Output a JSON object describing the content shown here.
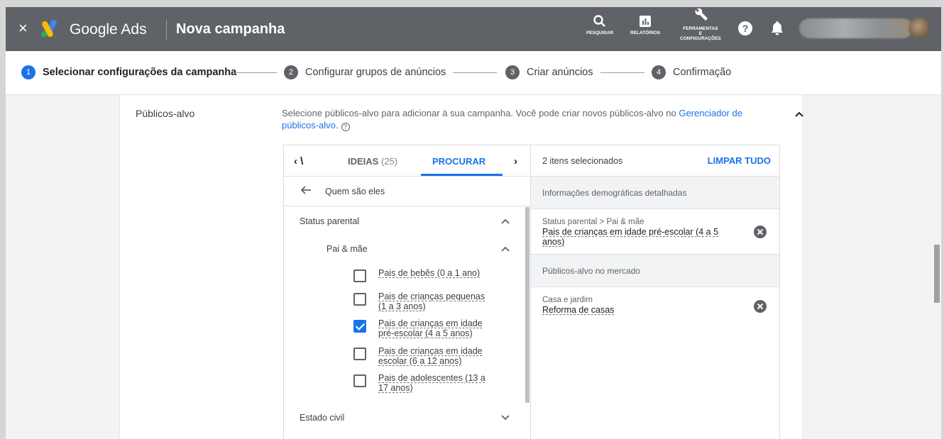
{
  "app": {
    "brand": "Google Ads",
    "title": "Nova campanha",
    "close_glyph": "×"
  },
  "topbar": {
    "search_label": "PESQUISAR",
    "reports_label": "RELATÓRIOS",
    "tools_label_line1": "FERRAMENTAS",
    "tools_label_line2": "E",
    "tools_label_line3": "CONFIGURAÇÕES",
    "help_glyph": "?",
    "icons": [
      "close-icon",
      "google-ads-logo",
      "search-icon",
      "reports-icon",
      "wrench-icon",
      "help-icon",
      "bell-icon"
    ]
  },
  "stepper": {
    "steps": [
      {
        "num": "1",
        "label": "Selecionar configurações da campanha",
        "active": true
      },
      {
        "num": "2",
        "label": "Configurar grupos de anúncios",
        "active": false
      },
      {
        "num": "3",
        "label": "Criar anúncios",
        "active": false
      },
      {
        "num": "4",
        "label": "Confirmação",
        "active": false
      }
    ]
  },
  "section": {
    "title": "Públicos-alvo",
    "desc_prefix": "Selecione públicos-alvo para adicionar à sua campanha. Você pode criar novos públicos-alvo no ",
    "desc_link": "Gerenciador de públicos-alvo",
    "desc_suffix": ".",
    "help_glyph": "?"
  },
  "browse": {
    "tab_prev_glyph": "‹ \\",
    "tab_ideas": "IDEIAS",
    "tab_ideas_count": "(25)",
    "tab_search": "PROCURAR",
    "tab_next_glyph": "›",
    "back_label": "Quem são eles",
    "category": "Status parental",
    "subcategory": "Pai & mãe",
    "options": [
      {
        "label": "Pais de bebês (0 a 1 ano)",
        "checked": false
      },
      {
        "label": "Pais de crianças pequenas (1 a 3 anos)",
        "checked": false
      },
      {
        "label": "Pais de crianças em idade pré-escolar (4 a 5 anos)",
        "checked": true
      },
      {
        "label": "Pais de crianças em idade escolar (6 a 12 anos)",
        "checked": false
      },
      {
        "label": "Pais de adolescentes (13 a 17 anos)",
        "checked": false
      }
    ],
    "next_category": "Estado civil"
  },
  "selected": {
    "count_label": "2 itens selecionados",
    "clear_label": "LIMPAR TUDO",
    "groups": [
      {
        "heading": "Informações demográficas detalhadas",
        "items": [
          {
            "path": "Status parental > Pai & mãe",
            "name": "Pais de crianças em idade pré-escolar (4 a 5 anos)"
          }
        ]
      },
      {
        "heading": "Públicos-alvo no mercado",
        "items": [
          {
            "path": "Casa e jardim",
            "name": "Reforma de casas"
          }
        ]
      }
    ]
  },
  "colors": {
    "accent": "#1a73e8",
    "topbar": "#5f6368"
  }
}
